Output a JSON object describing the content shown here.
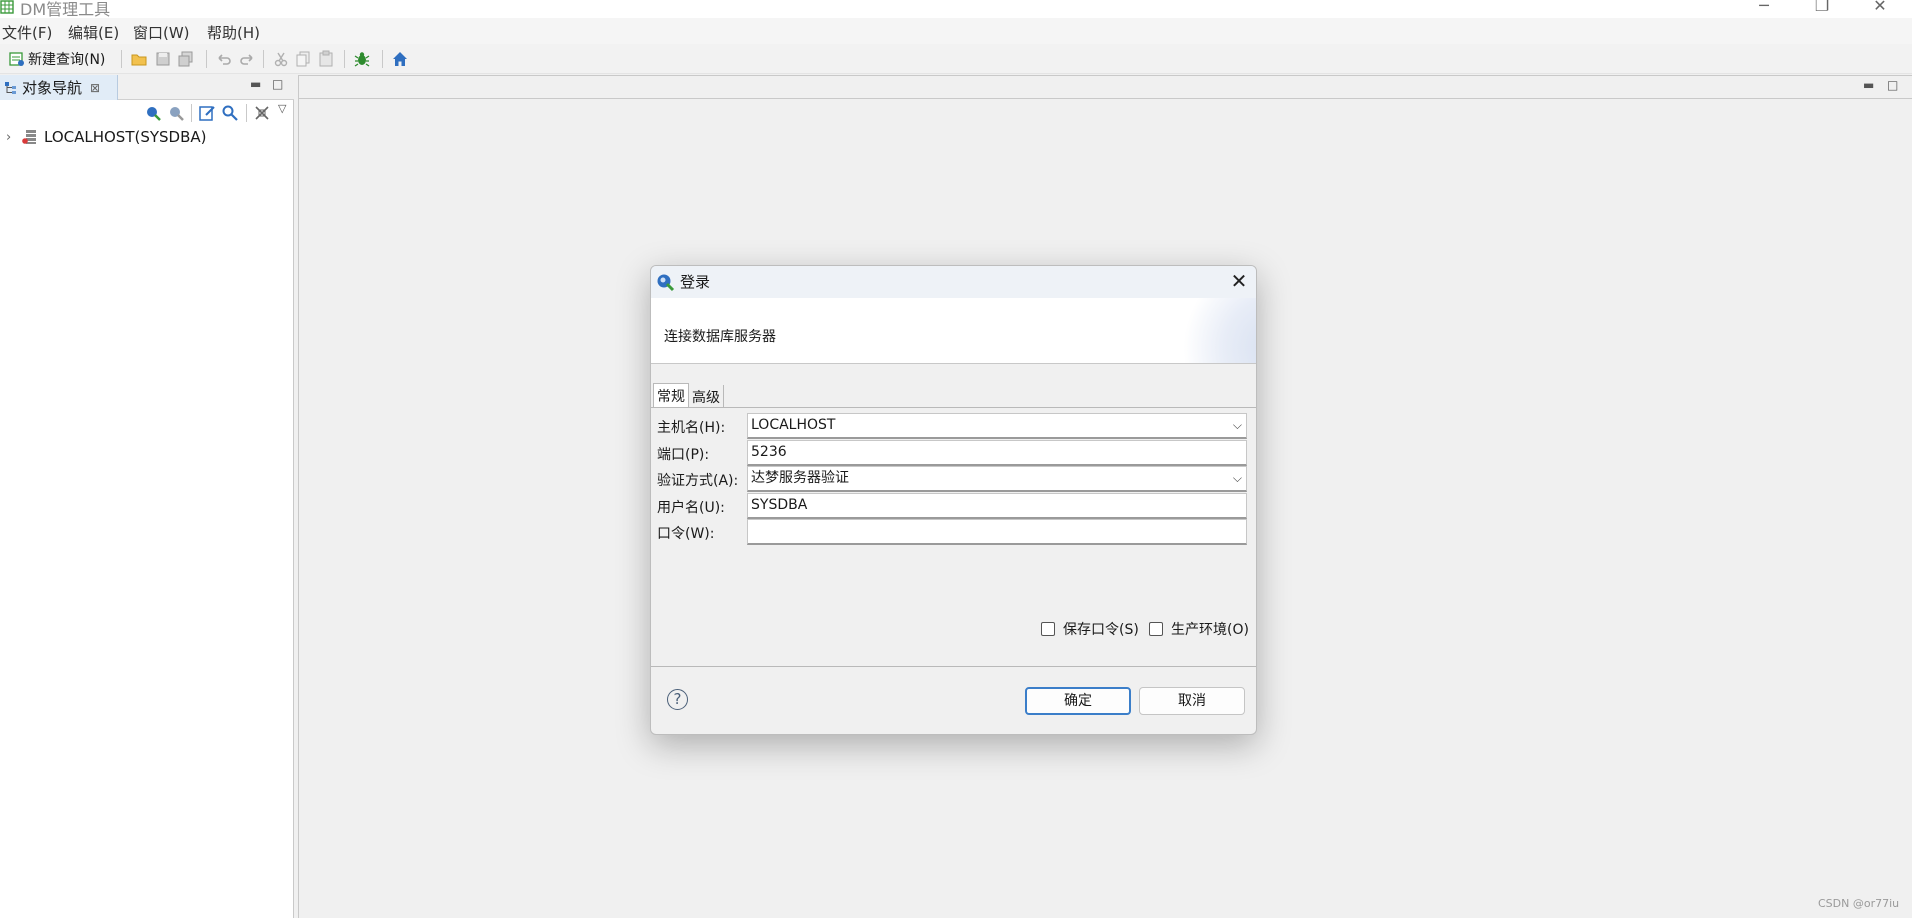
{
  "window": {
    "title": "DM管理工具",
    "minimize_glyph": "─",
    "restore_glyph": "❐",
    "close_glyph": "✕"
  },
  "menu": [
    "文件(F)",
    "编辑(E)",
    "窗口(W)",
    "帮助(H)"
  ],
  "toolbar": {
    "new_query_label": "新建查询(N)",
    "icons": [
      "open-folder-icon",
      "save-icon",
      "save-all-icon",
      "undo-icon",
      "redo-icon",
      "cut-icon",
      "copy-icon",
      "paste-icon",
      "debug-bug-icon",
      "home-icon"
    ]
  },
  "navigator": {
    "tab_label": "对象导航",
    "tab_close_glyph": "⊠",
    "tree": [
      {
        "label": "LOCALHOST(SYSDBA)",
        "expander": "›"
      }
    ]
  },
  "dialog": {
    "title": "登录",
    "close_glyph": "✕",
    "description": "连接数据库服务器",
    "tabs": [
      "常规",
      "高级"
    ],
    "fields": {
      "host_label": "主机名(H):",
      "host_value": "LOCALHOST",
      "port_label": "端口(P):",
      "port_value": "5236",
      "auth_label": "验证方式(A):",
      "auth_value": "达梦服务器验证",
      "user_label": "用户名(U):",
      "user_value": "SYSDBA",
      "password_label": "口令(W):",
      "password_value": ""
    },
    "save_password_label": "保存口令(S)",
    "save_password_checked": false,
    "production_env_label": "生产环境(O)",
    "production_env_checked": false,
    "help_glyph": "?",
    "ok_label": "确定",
    "cancel_label": "取消"
  },
  "colors": {
    "accent_blue": "#3b7ec9",
    "icon_green": "#3a9a3a",
    "icon_blue": "#2f6fc0"
  },
  "watermark": "CSDN @or77iu"
}
